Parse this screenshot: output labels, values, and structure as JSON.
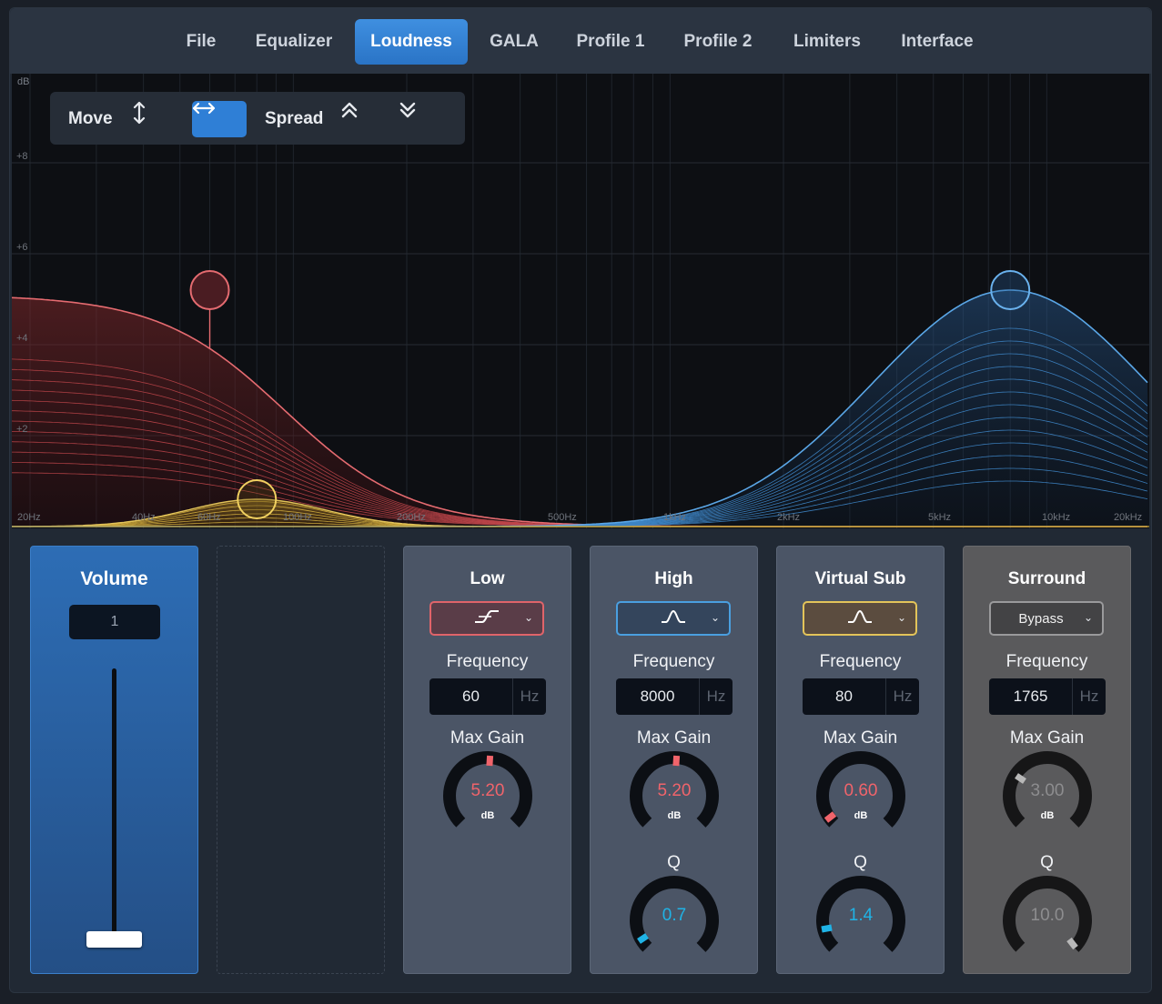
{
  "tabs": [
    "File",
    "Equalizer",
    "Loudness",
    "GALA",
    "Profile 1",
    "Profile 2",
    "Limiters",
    "Interface"
  ],
  "active_tab": "Loudness",
  "graph": {
    "unit": "dB",
    "y_labels": [
      "+8",
      "+6",
      "+4",
      "+2"
    ],
    "x_labels": [
      "20Hz",
      "40Hz",
      "60Hz",
      "100Hz",
      "200Hz",
      "500Hz",
      "1kHz",
      "2kHz",
      "5kHz",
      "10kHz",
      "20kHz"
    ],
    "toolbar": {
      "move_label": "Move",
      "spread_label": "Spread"
    }
  },
  "volume": {
    "title": "Volume",
    "value": "1",
    "slider_level": 0.0
  },
  "bands": {
    "low": {
      "title": "Low",
      "filter_icon": "low-shelf-icon",
      "frequency_label": "Frequency",
      "frequency": "60",
      "unit": "Hz",
      "max_gain_label": "Max Gain",
      "max_gain": "5.20",
      "gain_unit": "dB",
      "color": "#e0646a"
    },
    "high": {
      "title": "High",
      "filter_icon": "peak-filter-icon",
      "frequency_label": "Frequency",
      "frequency": "8000",
      "unit": "Hz",
      "max_gain_label": "Max Gain",
      "max_gain": "5.20",
      "gain_unit": "dB",
      "q_label": "Q",
      "q": "0.7",
      "color": "#4a9fe0"
    },
    "vsub": {
      "title": "Virtual Sub",
      "filter_icon": "peak-filter-icon",
      "frequency_label": "Frequency",
      "frequency": "80",
      "unit": "Hz",
      "max_gain_label": "Max Gain",
      "max_gain": "0.60",
      "gain_unit": "dB",
      "q_label": "Q",
      "q": "1.4",
      "color": "#e3c45a"
    },
    "surround": {
      "title": "Surround",
      "mode": "Bypass",
      "frequency_label": "Frequency",
      "frequency": "1765",
      "unit": "Hz",
      "max_gain_label": "Max Gain",
      "max_gain": "3.00",
      "gain_unit": "dB",
      "q_label": "Q",
      "q": "10.0"
    }
  },
  "colors": {
    "accent": "#2f7fd6",
    "low": "#e0646a",
    "high": "#4a9fe0",
    "vsub": "#e3c45a",
    "gain_text": "#f0646b",
    "q_text": "#1fb3e6"
  }
}
